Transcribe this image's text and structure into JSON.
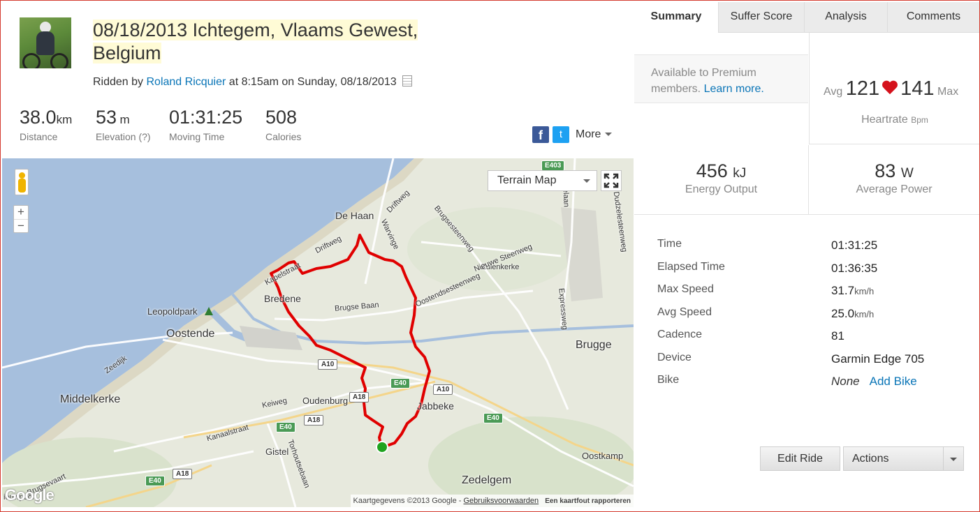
{
  "activity": {
    "title_line1": "08/18/2013 Ichtegem, Vlaams Gewest,",
    "title_line2": "Belgium",
    "by_prefix": "Ridden by",
    "athlete": "Roland Ricquier",
    "by_suffix": "at 8:15am on Sunday, 08/18/2013"
  },
  "stats": [
    {
      "value": "38.0",
      "unit": "km",
      "label": "Distance"
    },
    {
      "value": "53",
      "unit": "m",
      "label": "Elevation (?)"
    },
    {
      "value": "01:31:25",
      "unit": "",
      "label": "Moving Time"
    },
    {
      "value": "508",
      "unit": "",
      "label": "Calories"
    }
  ],
  "share": {
    "fb": "f",
    "tw": "t",
    "more": "More"
  },
  "map": {
    "type_label": "Terrain Map",
    "attribution": "Kaartgegevens ©2013 Google -",
    "terms": "Gebruiksvoorwaarden",
    "report": "Een kaartfout rapporteren",
    "logo": "Google",
    "zoom_in": "+",
    "zoom_out": "−",
    "places": {
      "de_haan": "De Haan",
      "bredene": "Bredene",
      "leopoldpark": "Leopoldpark",
      "oostende": "Oostende",
      "brugge": "Brugge",
      "middelkerke": "Middelkerke",
      "oudenburg": "Oudenburg",
      "jabbeke": "Jabbeke",
      "gistel": "Gistel",
      "zedelgem": "Zedelgem",
      "oostkamp": "Oostkamp",
      "zuienkerke": "Zuienkerke",
      "brugse_baan": "Brugse Baan",
      "driftweg1": "Driftweg",
      "driftweg2": "Driftweg",
      "kapelstraat": "Kapelstraat",
      "warving": "Warvinge",
      "brugsesteenweg": "Brugsesteenweg",
      "nieuwe_steenweg": "Nieuwe Steenweg",
      "oostendsesteenweg": "Oostendsesteenweg",
      "expressweg": "Expressweg",
      "zeelaan": "Zeelaan",
      "dudzelesteenweg": "Dudzelesteenweg",
      "kanaalstraat": "Kanaalstraat",
      "keiweg": "Keiweg",
      "zeedijk": "Zeedijk",
      "torhoutsebaan": "Torhoutsebaan",
      "brugsevaart": "Brugsevaart",
      "nieuwpoort": "ieuwpoort"
    },
    "shields": {
      "e403": "E403",
      "a10a": "A10",
      "a10b": "A10",
      "e40a": "E40",
      "e40b": "E40",
      "e40c": "E40",
      "e40d": "E40",
      "a18a": "A18",
      "a18b": "A18",
      "a18c": "A18"
    }
  },
  "tabs": [
    "Summary",
    "Suffer Score",
    "Analysis",
    "Comments"
  ],
  "premium": {
    "text": "Available to Premium members.",
    "link": "Learn more."
  },
  "heartrate": {
    "avg_label": "Avg",
    "avg": "121",
    "max": "141",
    "max_label": "Max",
    "label": "Heartrate",
    "unit": "Bpm"
  },
  "energy": {
    "value": "456",
    "unit": "kJ",
    "label": "Energy Output"
  },
  "power": {
    "value": "83",
    "unit": "W",
    "label": "Average Power"
  },
  "details": [
    {
      "key": "Time",
      "value": "01:31:25",
      "unit": ""
    },
    {
      "key": "Elapsed Time",
      "value": "01:36:35",
      "unit": ""
    },
    {
      "key": "Max Speed",
      "value": "31.7",
      "unit": "km/h"
    },
    {
      "key": "Avg Speed",
      "value": "25.0",
      "unit": "km/h"
    },
    {
      "key": "Cadence",
      "value": "81",
      "unit": ""
    },
    {
      "key": "Device",
      "value": "Garmin Edge 705",
      "unit": ""
    }
  ],
  "bike": {
    "key": "Bike",
    "value": "None",
    "link": "Add Bike"
  },
  "buttons": {
    "edit": "Edit Ride",
    "actions": "Actions"
  },
  "colors": {
    "route": "#e00000",
    "accent": "#0a75b7",
    "frame": "#d43a2f",
    "heart": "#d5121c"
  }
}
